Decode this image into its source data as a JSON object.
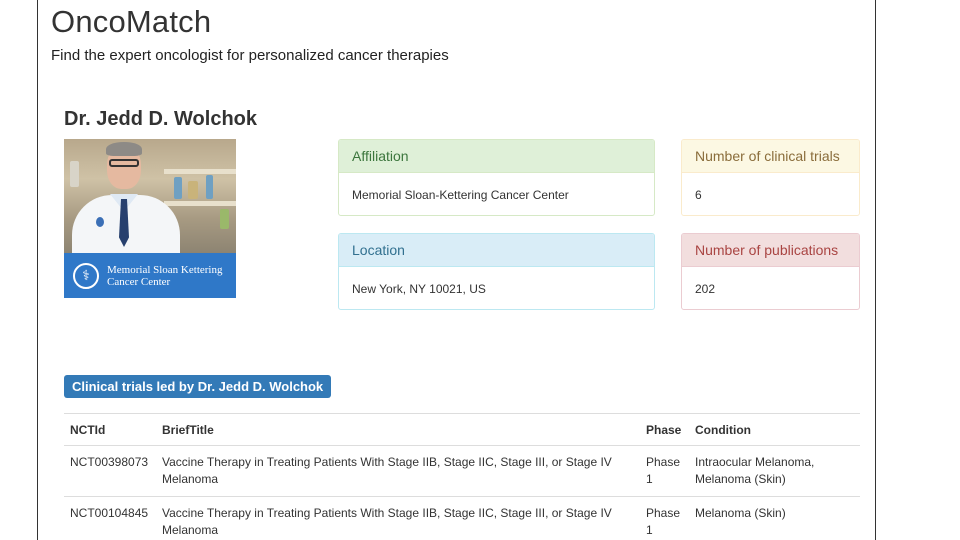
{
  "app": {
    "title": "OncoMatch",
    "subtitle": "Find the expert oncologist for personalized cancer therapies"
  },
  "doctor": {
    "name": "Dr. Jedd D. Wolchok",
    "photo_banner_text_line1": "Memorial Sloan Kettering",
    "photo_banner_text_line2": "Cancer Center"
  },
  "panels": {
    "affiliation": {
      "heading": "Affiliation",
      "value": "Memorial Sloan-Kettering Cancer Center"
    },
    "clinical_trials": {
      "heading": "Number of clinical trials",
      "value": "6"
    },
    "location": {
      "heading": "Location",
      "value": "New York, NY 10021, US"
    },
    "publications": {
      "heading": "Number of publications",
      "value": "202"
    }
  },
  "trials": {
    "label": "Clinical trials led by Dr. Jedd D. Wolchok",
    "columns": [
      "NCTId",
      "BriefTitle",
      "Phase",
      "Condition"
    ],
    "rows": [
      {
        "id": "NCT00398073",
        "title": "Vaccine Therapy in Treating Patients With Stage IIB, Stage IIC, Stage III, or Stage IV Melanoma",
        "phase": "Phase 1",
        "condition": "Intraocular Melanoma, Melanoma (Skin)"
      },
      {
        "id": "NCT00104845",
        "title": "Vaccine Therapy in Treating Patients With Stage IIB, Stage IIC, Stage III, or Stage IV Melanoma",
        "phase": "Phase 1",
        "condition": "Melanoma (Skin)"
      }
    ]
  },
  "colors": {
    "success_bg": "#dff0d8",
    "warning_bg": "#fcf8e3",
    "info_bg": "#d9edf7",
    "danger_bg": "#f2dede",
    "label_primary": "#337ab7",
    "banner_blue": "#2f78c8"
  }
}
